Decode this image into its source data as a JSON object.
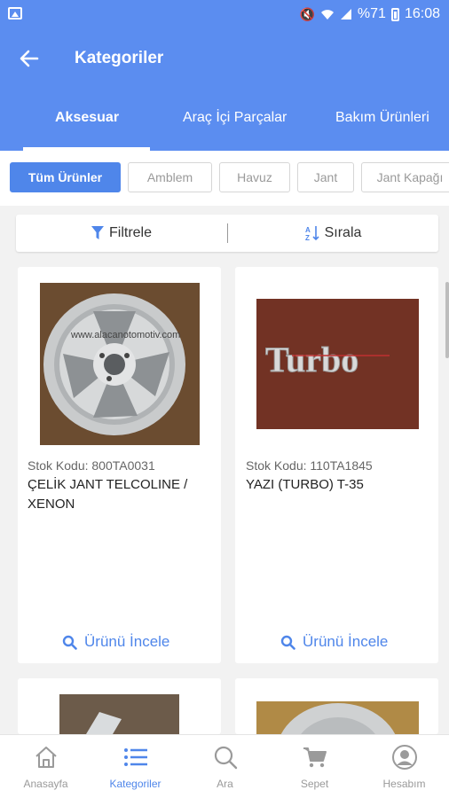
{
  "status_bar": {
    "battery": "%71",
    "time": "16:08"
  },
  "header": {
    "title": "Kategoriler"
  },
  "tabs": [
    {
      "label": "Aksesuar",
      "active": true
    },
    {
      "label": "Araç İçi Parçalar",
      "active": false
    },
    {
      "label": "Bakım Ürünleri",
      "active": false
    }
  ],
  "chips": [
    {
      "label": "Tüm Ürünler",
      "active": true
    },
    {
      "label": "Amblem",
      "active": false
    },
    {
      "label": "Havuz",
      "active": false
    },
    {
      "label": "Jant",
      "active": false
    },
    {
      "label": "Jant Kapağı",
      "active": false
    }
  ],
  "toolbar": {
    "filter_label": "Filtrele",
    "sort_label": "Sırala"
  },
  "products": [
    {
      "stock": "Stok Kodu: 800TA0031",
      "name_line1": "ÇELİK JANT TELCOLINE /",
      "name_line2": "XENON",
      "image_text": "www.alacanotomotiv.com",
      "action": "Ürünü İncele"
    },
    {
      "stock": "Stok Kodu: 110TA1845",
      "name_line1": "YAZI (TURBO) T-35",
      "name_line2": "",
      "image_text": "Turbo",
      "action": "Ürünü İncele"
    }
  ],
  "bottom_nav": [
    {
      "label": "Anasayfa",
      "icon": "home-icon",
      "active": false
    },
    {
      "label": "Kategoriler",
      "icon": "list-icon",
      "active": true
    },
    {
      "label": "Ara",
      "icon": "search-icon",
      "active": false
    },
    {
      "label": "Sepet",
      "icon": "cart-icon",
      "active": false
    },
    {
      "label": "Hesabım",
      "icon": "account-icon",
      "active": false
    }
  ],
  "colors": {
    "primary": "#5b8df0",
    "accent": "#4f86ea",
    "background": "#f2f2f2"
  }
}
